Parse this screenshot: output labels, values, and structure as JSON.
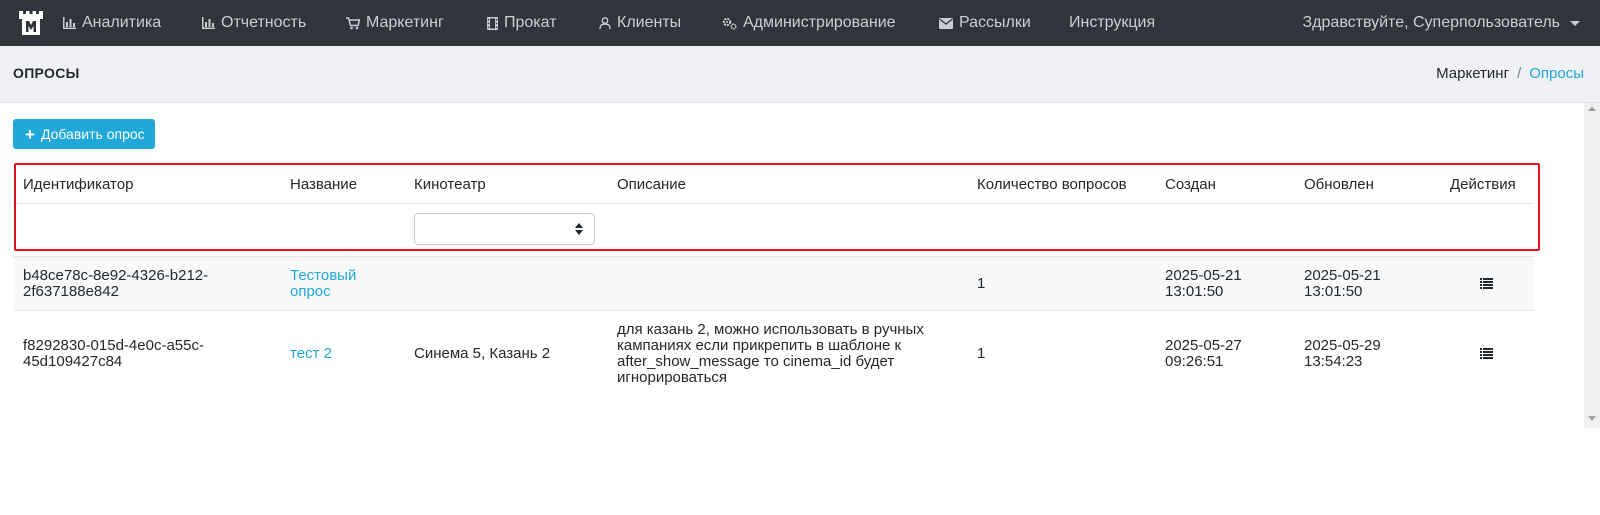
{
  "navbar": {
    "brand_icon": "castle-logo-icon",
    "items": [
      {
        "label": "Аналитика",
        "icon": "bar-chart-icon"
      },
      {
        "label": "Отчетность",
        "icon": "bar-chart-icon"
      },
      {
        "label": "Маркетинг",
        "icon": "cart-icon"
      },
      {
        "label": "Прокат",
        "icon": "film-icon"
      },
      {
        "label": "Клиенты",
        "icon": "user-icon"
      },
      {
        "label": "Администрирование",
        "icon": "gears-icon"
      },
      {
        "label": "Рассылки",
        "icon": "envelope-icon"
      },
      {
        "label": "Инструкция",
        "icon": ""
      }
    ],
    "user_greeting": "Здравствуйте, Суперпользователь"
  },
  "page": {
    "title": "ОПРОСЫ",
    "breadcrumb": [
      "Маркетинг",
      "Опросы"
    ],
    "add_button_label": "Добавить опрос"
  },
  "table": {
    "columns": [
      "Идентификатор",
      "Название",
      "Кинотеатр",
      "Описание",
      "Количество вопросов",
      "Создан",
      "Обновлен",
      "Действия"
    ],
    "cinema_filter_value": "",
    "rows": [
      {
        "id_line1": "b48ce78c-8e92-4326-b212-",
        "id_line2": "2f637188e842",
        "name_line1": "Тестовый",
        "name_line2": "опрос",
        "cinema": "",
        "description": [],
        "questions": "1",
        "created_date": "2025-05-21",
        "created_time": "13:01:50",
        "updated_date": "2025-05-21",
        "updated_time": "13:01:50",
        "action_icon": "list-icon"
      },
      {
        "id_line1": "f8292830-015d-4e0c-a55c-",
        "id_line2": "45d109427c84",
        "name_line1": "тест 2",
        "name_line2": "",
        "cinema": "Синема 5, Казань 2",
        "description": [
          "для казань 2, можно использовать в ручных",
          "кампаниях если прикрепить в шаблоне к",
          "after_show_message то cinema_id будет",
          "игнорироваться"
        ],
        "questions": "1",
        "created_date": "2025-05-27",
        "created_time": "09:26:51",
        "updated_date": "2025-05-29",
        "updated_time": "13:54:23",
        "action_icon": "list-icon"
      }
    ]
  },
  "colors": {
    "navbar_bg": "#2f353a",
    "accent": "#20a8d8",
    "highlight_border": "#e0141e"
  }
}
